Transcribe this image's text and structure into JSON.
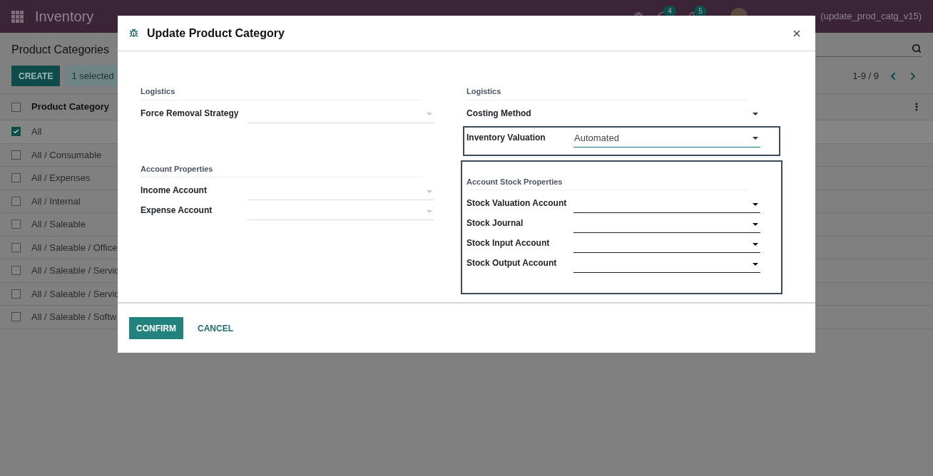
{
  "navbar": {
    "app_name": "Inventory",
    "chat_badge": "4",
    "activity_badge": "5",
    "user": "(update_prod_catg_v15)"
  },
  "control_panel": {
    "title": "Product Categories",
    "create_button": "CREATE",
    "selection": "1 selected",
    "pager": "1-9 / 9"
  },
  "list": {
    "column": "Product Category",
    "header_checked": false,
    "rows": [
      {
        "name": "All",
        "checked": true
      },
      {
        "name": "All / Consumable",
        "checked": false
      },
      {
        "name": "All / Expenses",
        "checked": false
      },
      {
        "name": "All / Internal",
        "checked": false
      },
      {
        "name": "All / Saleable",
        "checked": false
      },
      {
        "name": "All / Saleable / Office",
        "checked": false
      },
      {
        "name": "All / Saleable / Servic",
        "checked": false
      },
      {
        "name": "All / Saleable / Servic",
        "checked": false
      },
      {
        "name": "All / Saleable / Softw",
        "checked": false
      }
    ]
  },
  "dialog": {
    "title": "Update Product Category",
    "left_groups": [
      {
        "title": "Logistics",
        "highlighted": false,
        "fields": [
          {
            "label": "Force Removal Strategy",
            "kind": "muted",
            "highlighted": false
          }
        ]
      },
      {
        "title": "Account Properties",
        "highlighted": false,
        "fields": [
          {
            "label": "Income Account",
            "kind": "muted",
            "highlighted": false
          },
          {
            "label": "Expense Account",
            "kind": "muted",
            "highlighted": false
          }
        ]
      }
    ],
    "right_groups": [
      {
        "title": "Logistics",
        "highlighted": false,
        "fields": [
          {
            "label": "Costing Method",
            "kind": "bare",
            "highlighted": false
          },
          {
            "label": "Inventory Valuation",
            "kind": "focused",
            "value": "Automated",
            "highlighted": true
          }
        ]
      },
      {
        "title": "Account Stock Properties",
        "highlighted": true,
        "fields": [
          {
            "label": "Stock Valuation Account",
            "kind": "dark",
            "highlighted": false
          },
          {
            "label": "Stock Journal",
            "kind": "dark",
            "highlighted": false
          },
          {
            "label": "Stock Input Account",
            "kind": "dark",
            "highlighted": false
          },
          {
            "label": "Stock Output Account",
            "kind": "dark",
            "highlighted": false
          }
        ]
      }
    ],
    "buttons": [
      {
        "label": "CONFIRM",
        "kind": "primary"
      },
      {
        "label": "CANCEL",
        "kind": "link"
      }
    ]
  }
}
